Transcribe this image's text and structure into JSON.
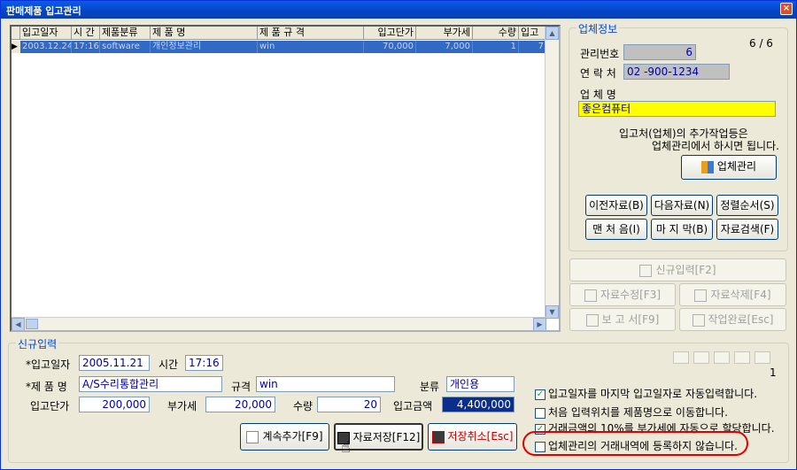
{
  "window": {
    "title": "판매제품 입고관리",
    "close": "×"
  },
  "grid": {
    "columns": [
      "입고일자",
      "시 간",
      "제품분류",
      "제 품 명",
      "제 품 규 격",
      "입고단가",
      "부가세",
      "수량",
      "입고"
    ],
    "rows": [
      [
        "2003.12.24",
        "17:16",
        "software",
        "개인정보관리",
        "win",
        "70,000",
        "7,000",
        "1",
        "7"
      ]
    ]
  },
  "vendor": {
    "group_label": "업체정보",
    "id_label": "관리번호",
    "id_value": "6",
    "counter": "6 / 6",
    "contact_label": "연 락 처",
    "contact_value": "02  -900-1234",
    "name_label": "업 체 명",
    "name_value": "좋은컴퓨터",
    "note_line1": "입고처(업체)의 추가작업등은",
    "note_line2": "업체관리에서 하시면 됩니다.",
    "manage_button": "업체관리",
    "nav_buttons": [
      "이전자료(B)",
      "다음자료(N)",
      "정렬순서(S)",
      "맨 처 음(I)",
      "마 지 막(B)",
      "자료검색(F)"
    ]
  },
  "actions": {
    "new_entry": "신규입력[F2]",
    "edit": "자료수정[F3]",
    "delete": "자료삭제[F4]",
    "report": "보 고 서[F9]",
    "done": "작업완료[Esc]"
  },
  "entry": {
    "group_label": "신규입력",
    "date_label": "*입고일자",
    "date_value": "2005.11.21",
    "time_label": "시간",
    "time_value": "17:16",
    "product_label": "*제 품 명",
    "product_value": "A/S수리통합관리",
    "spec_label": "규격",
    "spec_value": "win",
    "category_label": "분류",
    "category_value": "개인용",
    "price_label": "입고단가",
    "price_value": "200,000",
    "vat_label": "부가세",
    "vat_value": "20,000",
    "qty_label": "수량",
    "qty_value": "20",
    "amount_label": "입고금액",
    "amount_value": "4,400,000",
    "page_number": "1",
    "continue_button": "계속추가[F9]",
    "save_button": "자료저장[F12]",
    "cancel_button": "저장취소[Esc]"
  },
  "options": [
    {
      "label": "입고일자를 마지막 입고일자로 자동입력합니다.",
      "checked": true
    },
    {
      "label": "처음 입력위치를 제품명으로 이동합니다.",
      "checked": false
    },
    {
      "label": "거래금액의 10%를 부가세에 자동으로 할당합니다.",
      "checked": true
    },
    {
      "label": "업체관리의 거래내역에 등록하지 않습니다.",
      "checked": false
    }
  ],
  "check_mark": "✓"
}
